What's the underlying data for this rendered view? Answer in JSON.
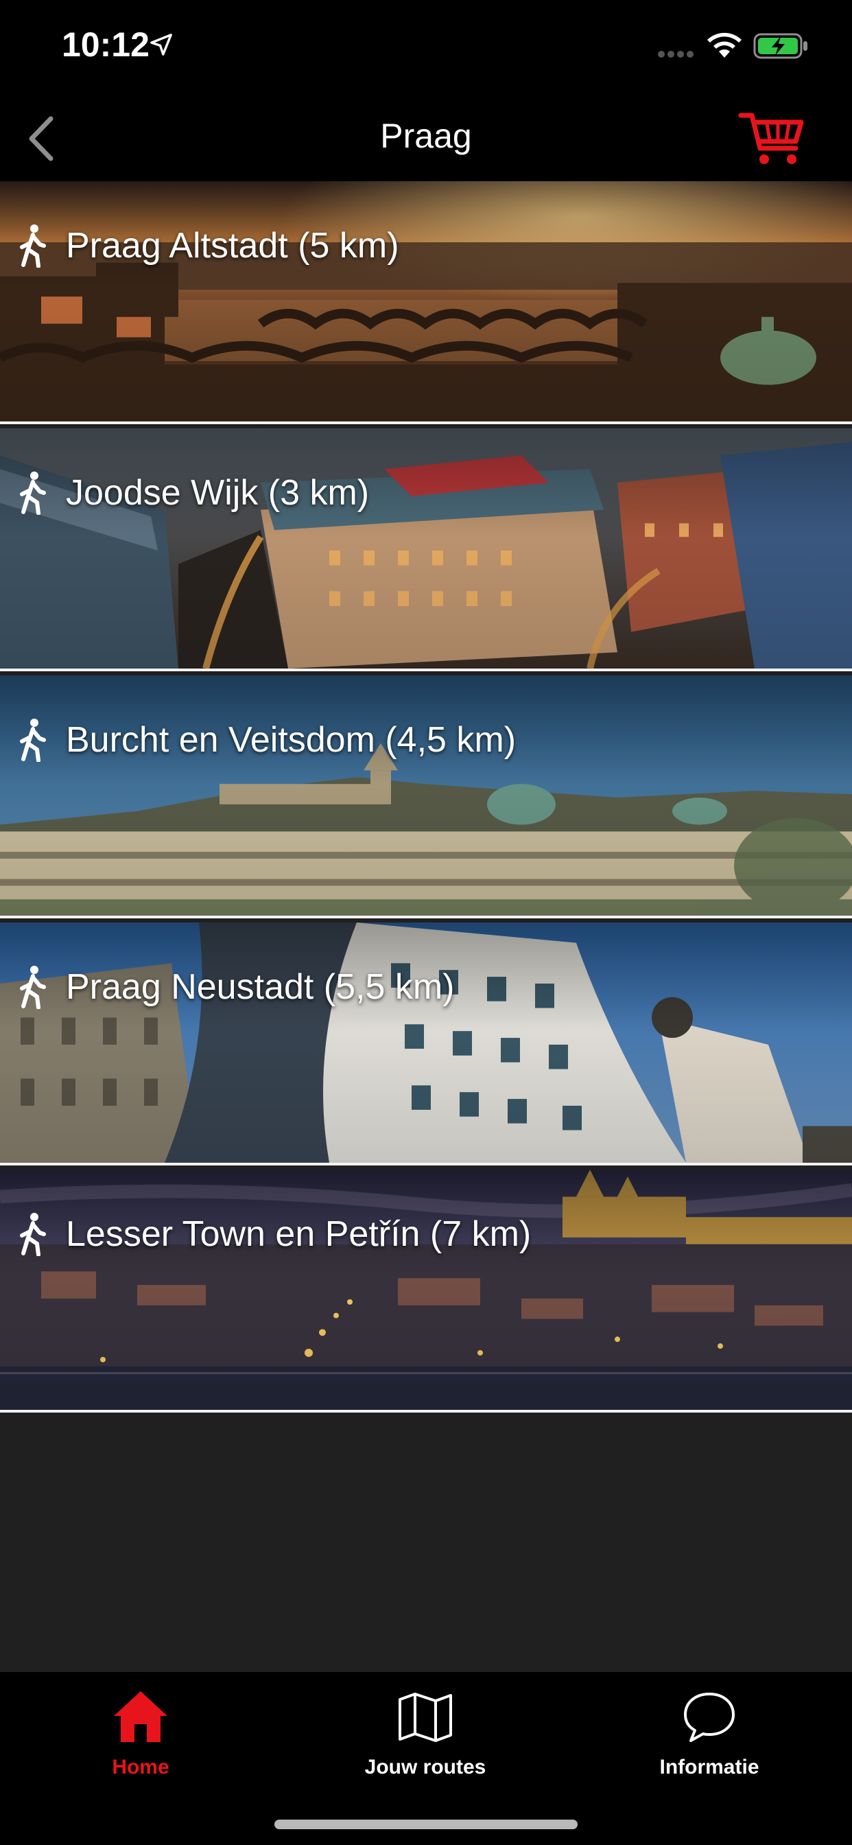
{
  "status_bar": {
    "time": "10:12"
  },
  "nav": {
    "title": "Praag"
  },
  "routes": [
    {
      "label": "Praag Altstadt (5 km)",
      "icon": "walking-person-icon",
      "scene": "charles-bridge-sunset"
    },
    {
      "label": "Joodse Wijk (3 km)",
      "icon": "walking-person-icon",
      "scene": "jewish-quarter-aerial"
    },
    {
      "label": "Burcht en Veitsdom (4,5 km)",
      "icon": "walking-person-icon",
      "scene": "castle-panorama"
    },
    {
      "label": "Praag Neustadt (5,5 km)",
      "icon": "walking-person-icon",
      "scene": "dancing-house"
    },
    {
      "label": "Lesser Town en Petřín (7 km)",
      "icon": "walking-person-icon",
      "scene": "lesser-town-night"
    }
  ],
  "tabs": [
    {
      "label": "Home",
      "icon": "home-icon",
      "active": true
    },
    {
      "label": "Jouw routes",
      "icon": "map-icon",
      "active": false
    },
    {
      "label": "Informatie",
      "icon": "chat-bubble-icon",
      "active": false
    }
  ],
  "colors": {
    "accent": "#e8141b",
    "background": "#202020",
    "bar": "#000000"
  }
}
